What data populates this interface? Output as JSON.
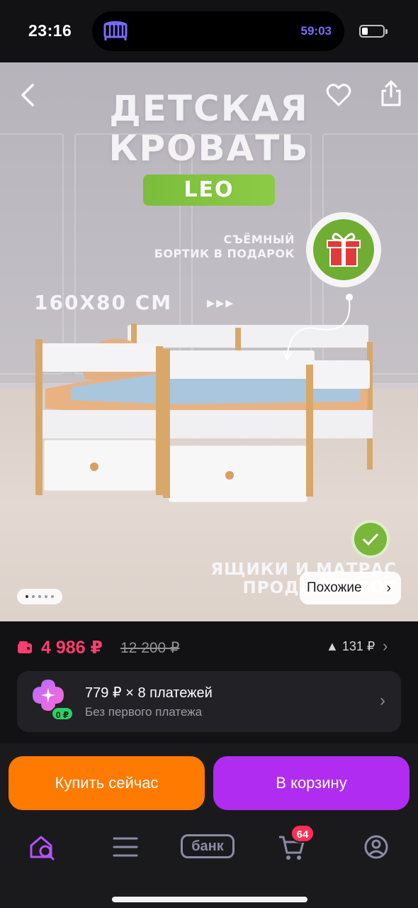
{
  "status_bar": {
    "time": "23:16",
    "activity_timer": "59:03",
    "activity_icon": "crib-icon",
    "battery_level": 0.2
  },
  "hero": {
    "title_line1": "ДЕТСКАЯ",
    "title_line2": "КРОВАТЬ",
    "model_badge": "LEO",
    "promo_line1": "СЪЁМНЫЙ",
    "promo_line2": "БОРТИК В ПОДАРОК",
    "size_label": "160X80 СМ",
    "bottom_line1": "ЯЩИКИ  И МАТРАС",
    "bottom_line2": "ПРОДАЮТСЯОТ",
    "similar_button": "Похожие",
    "gallery_pages": 5,
    "gallery_active_index": 0,
    "icons": [
      "back-icon",
      "heart-icon",
      "share-icon",
      "gift-icon",
      "check-icon"
    ],
    "accent_green": "#7bbd3b"
  },
  "price": {
    "current": "4 986 ₽",
    "old": "12 200 ₽",
    "points": "131 ₽",
    "current_color": "#ff3d6e"
  },
  "installment": {
    "title": "779 ₽ × 8 платежей",
    "subtitle": "Без первого платежа",
    "badge": "0 ₽"
  },
  "actions": {
    "buy_now": "Купить сейчас",
    "add_to_cart": "В корзину",
    "buy_color": "#ff7a00",
    "cart_color": "#b02cf0"
  },
  "nav": {
    "bank_label": "банк",
    "cart_count": "64",
    "items": [
      "home-search-icon",
      "menu-icon",
      "bank-icon",
      "cart-icon",
      "profile-icon"
    ]
  }
}
